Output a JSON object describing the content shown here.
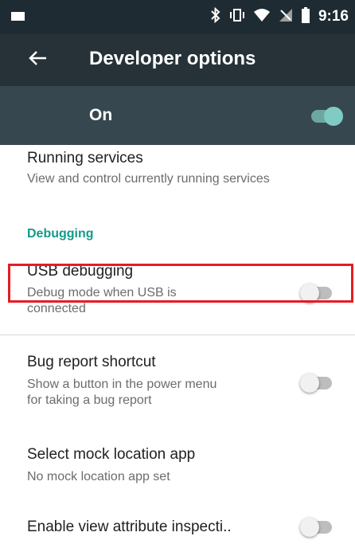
{
  "status_bar": {
    "time": "9:16",
    "icons": [
      "bluetooth-icon",
      "vibrate-icon",
      "wifi-icon",
      "no-signal-icon",
      "battery-icon"
    ]
  },
  "app_bar": {
    "title": "Developer options",
    "back_icon": "arrow-back-icon"
  },
  "master_switch": {
    "label": "On",
    "state": true
  },
  "items": [
    {
      "title": "Running services",
      "subtitle": "View and control currently running services"
    },
    {
      "section": "Debugging"
    },
    {
      "title": "USB debugging",
      "subtitle_line1": "Debug mode when USB is",
      "subtitle_line2": "connected",
      "toggle": false
    },
    {
      "title": "Bug report shortcut",
      "subtitle_line1": "Show a button in the power menu",
      "subtitle_line2": "for taking a bug report",
      "toggle": false
    },
    {
      "title": "Select mock location app",
      "subtitle": "No mock location app set"
    },
    {
      "title": "Enable view attribute inspecti..",
      "toggle": false
    }
  ],
  "colors": {
    "status_bar": "#1f2b32",
    "app_bar": "#263238",
    "master_bar": "#37474f",
    "accent": "#139b8a",
    "toggle_on": "#80cbc4",
    "highlight": "#e51c24"
  }
}
